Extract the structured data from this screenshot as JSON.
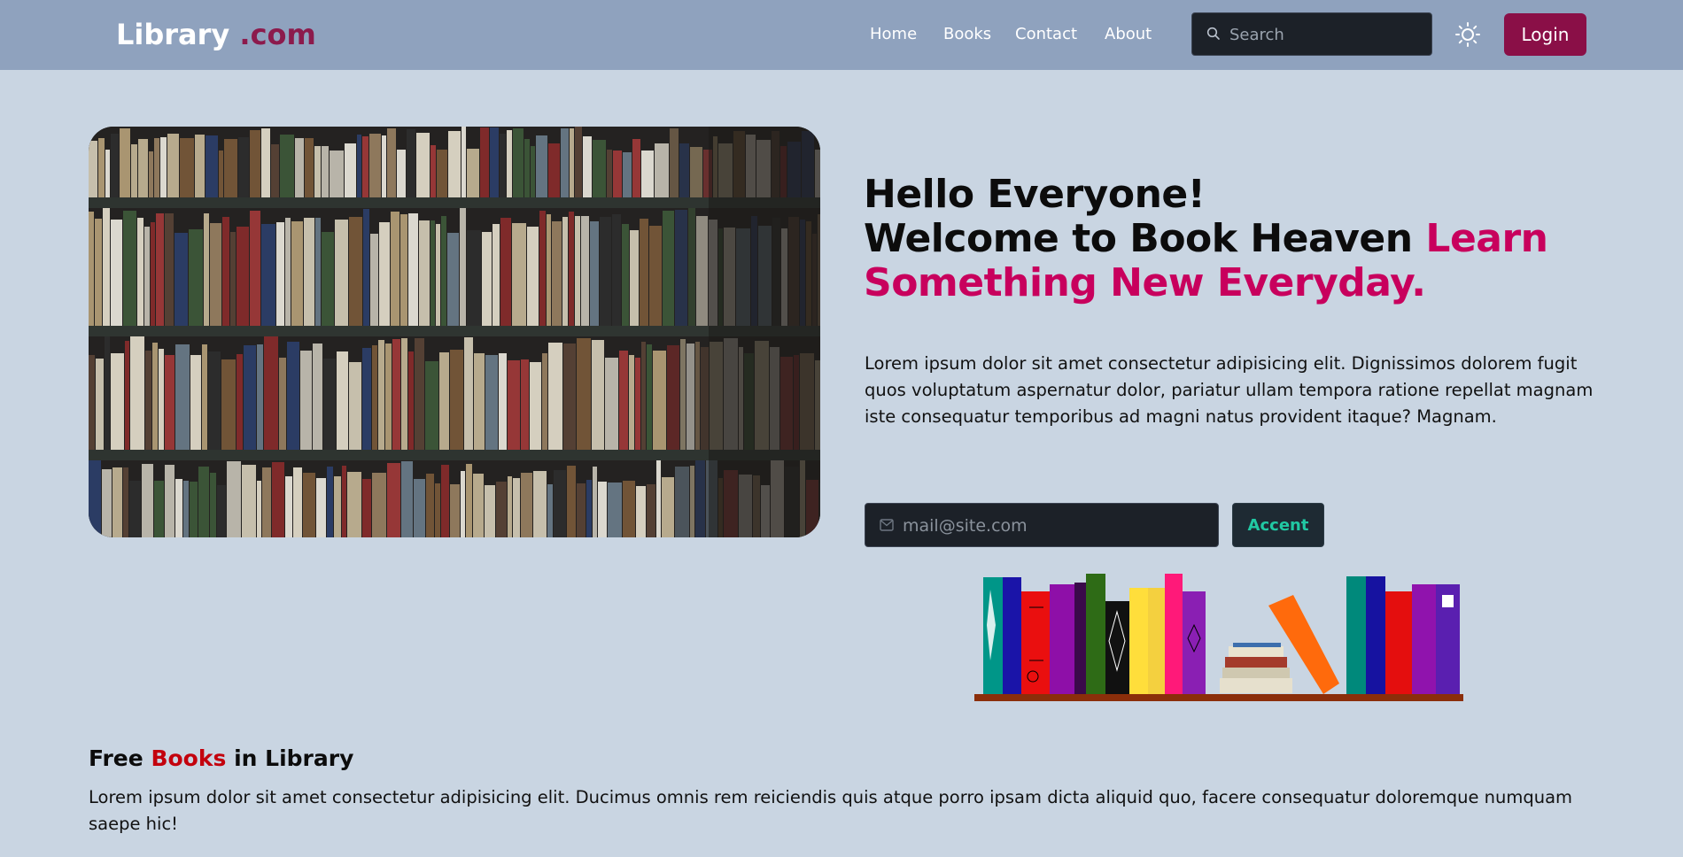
{
  "navbar": {
    "logo_main": "Library",
    "logo_accent": ".com",
    "links": [
      "Home",
      "Books",
      "Contact",
      "About"
    ],
    "search_placeholder": "Search",
    "login_label": "Login"
  },
  "hero": {
    "greeting": "Hello Everyone!",
    "welcome": "Welcome to Book Heaven",
    "highlight": "Learn Something New Everyday.",
    "description": "Lorem ipsum dolor sit amet consectetur adipisicing elit. Dignissimos dolorem fugit quos voluptatum aspernatur dolor, pariatur ullam tempora ratione repellat magnam iste consequatur temporibus ad magni natus provident itaque? Magnam.",
    "email_placeholder": "mail@site.com",
    "accent_label": "Accent"
  },
  "free_section": {
    "title_part1": "Free",
    "title_highlight": "Books",
    "title_part2": "in Library",
    "description": "Lorem ipsum dolor sit amet consectetur adipisicing elit. Ducimus omnis rem reiciendis quis atque porro ipsam dicta aliquid quo, facere consequatur doloremque numquam saepe hic!"
  },
  "icons": {
    "search": "search-icon",
    "theme": "sun-icon",
    "mail": "mail-icon"
  },
  "colors": {
    "navbar_bg": "#8fa2be",
    "page_bg": "#c9d5e2",
    "brand_accent": "#8a0f47",
    "heading_highlight": "#c8005d",
    "section_highlight": "#c3000d",
    "accent_button_text": "#21c8a3",
    "input_bg": "#1c2128"
  }
}
